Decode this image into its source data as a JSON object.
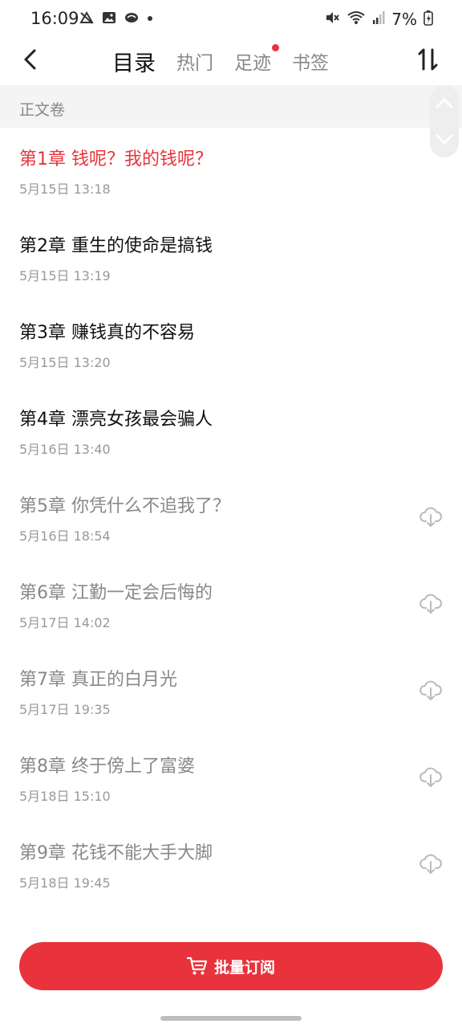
{
  "status_bar": {
    "time": "16:09",
    "battery": "7%"
  },
  "nav": {
    "tabs": [
      {
        "label": "目录",
        "active": true
      },
      {
        "label": "热门",
        "active": false
      },
      {
        "label": "足迹",
        "active": false,
        "badge_dot": true
      },
      {
        "label": "书签",
        "active": false
      }
    ]
  },
  "section": {
    "title": "正文卷"
  },
  "chapters": [
    {
      "title": "第1章 钱呢？我的钱呢？",
      "date": "5月15日 13:18",
      "state": "current"
    },
    {
      "title": "第2章 重生的使命是搞钱",
      "date": "5月15日 13:19",
      "state": "free"
    },
    {
      "title": "第3章 赚钱真的不容易",
      "date": "5月15日 13:20",
      "state": "free"
    },
    {
      "title": "第4章 漂亮女孩最会骗人",
      "date": "5月16日 13:40",
      "state": "free"
    },
    {
      "title": "第5章 你凭什么不追我了？",
      "date": "5月16日 18:54",
      "state": "locked"
    },
    {
      "title": "第6章 江勤一定会后悔的",
      "date": "5月17日 14:02",
      "state": "locked"
    },
    {
      "title": "第7章 真正的白月光",
      "date": "5月17日 19:35",
      "state": "locked"
    },
    {
      "title": "第8章 终于傍上了富婆",
      "date": "5月18日 15:10",
      "state": "locked"
    },
    {
      "title": "第9章 花钱不能大手大脚",
      "date": "5月18日 19:45",
      "state": "locked"
    }
  ],
  "bottom": {
    "batch_label": "批量订阅"
  },
  "colors": {
    "accent": "#e8333c",
    "section_bg": "#f4f4f4",
    "muted_text": "#888888",
    "date_text": "#999999"
  }
}
